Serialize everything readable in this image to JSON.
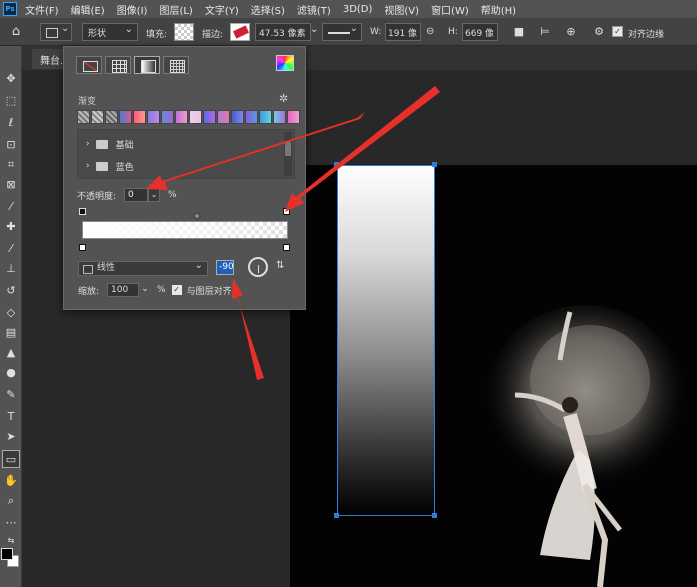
{
  "menubar": {
    "logo": "Ps",
    "items": [
      "文件(F)",
      "编辑(E)",
      "图像(I)",
      "图层(L)",
      "文字(Y)",
      "选择(S)",
      "滤镜(T)",
      "3D(D)",
      "视图(V)",
      "窗口(W)",
      "帮助(H)"
    ]
  },
  "options": {
    "mode": "形状",
    "fill_label": "填充:",
    "stroke_label": "描边:",
    "stroke_size": "47.53 像素",
    "w_label": "W:",
    "w_value": "191 像",
    "h_label": "H:",
    "h_value": "669 像",
    "align_edges_label": "对齐边缘"
  },
  "document": {
    "tab_name": "舞台.jp"
  },
  "gradient_panel": {
    "section_title": "渐变",
    "folders": [
      "基础",
      "蓝色"
    ],
    "opacity_label": "不透明度:",
    "opacity_value": "0",
    "opacity_unit": "%",
    "type_label": "线性",
    "angle_value": "-90",
    "scale_label": "缩放:",
    "scale_value": "100",
    "scale_unit": "%",
    "align_label": "与图层对齐",
    "presets_colors": [
      "#9a9a9a",
      "#b0b0b0",
      "#8f8f8f",
      "#d95a8a",
      "#ff5a7a",
      "#8a7ae0",
      "#6a8ad8",
      "#c070d8",
      "#e8d0f0",
      "#5a6ae8",
      "#b07ad0",
      "#4a5ad0",
      "#8a5ae0",
      "#3a9ae0",
      "#6ad0e0",
      "#e06ac0"
    ]
  },
  "colors": {
    "foreground": "#000000",
    "background": "#ffffff",
    "accent": "#2d7fd6",
    "annotation": "#e8302a"
  }
}
